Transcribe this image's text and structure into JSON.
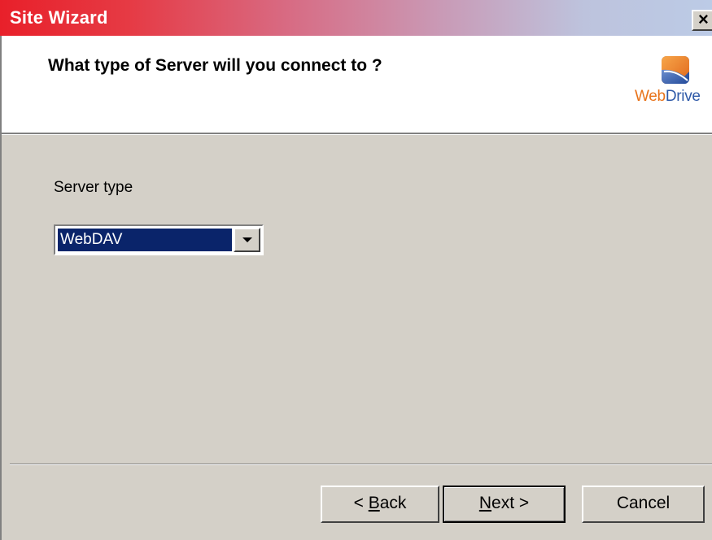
{
  "window": {
    "title": "Site Wizard",
    "close_label": "×",
    "title_gradient": [
      "#e8202a",
      "#bccbe6"
    ]
  },
  "header": {
    "heading": "What type of Server will you connect to ?",
    "logo": {
      "icon": "webdrive-logo-icon",
      "text_web": "Web",
      "text_drive": "Drive",
      "color_web": "#e8731a",
      "color_drive": "#2f5aa8"
    }
  },
  "form": {
    "server_type_label": "Server type",
    "server_type_value": "WebDAV"
  },
  "buttons": {
    "back": {
      "prefix": "< ",
      "mnemonic": "B",
      "rest": "ack"
    },
    "next": {
      "mnemonic": "N",
      "rest": "ext >"
    },
    "cancel": "Cancel"
  },
  "colors": {
    "dialog_bg": "#d4d0c8",
    "selection_bg": "#0a246a"
  }
}
